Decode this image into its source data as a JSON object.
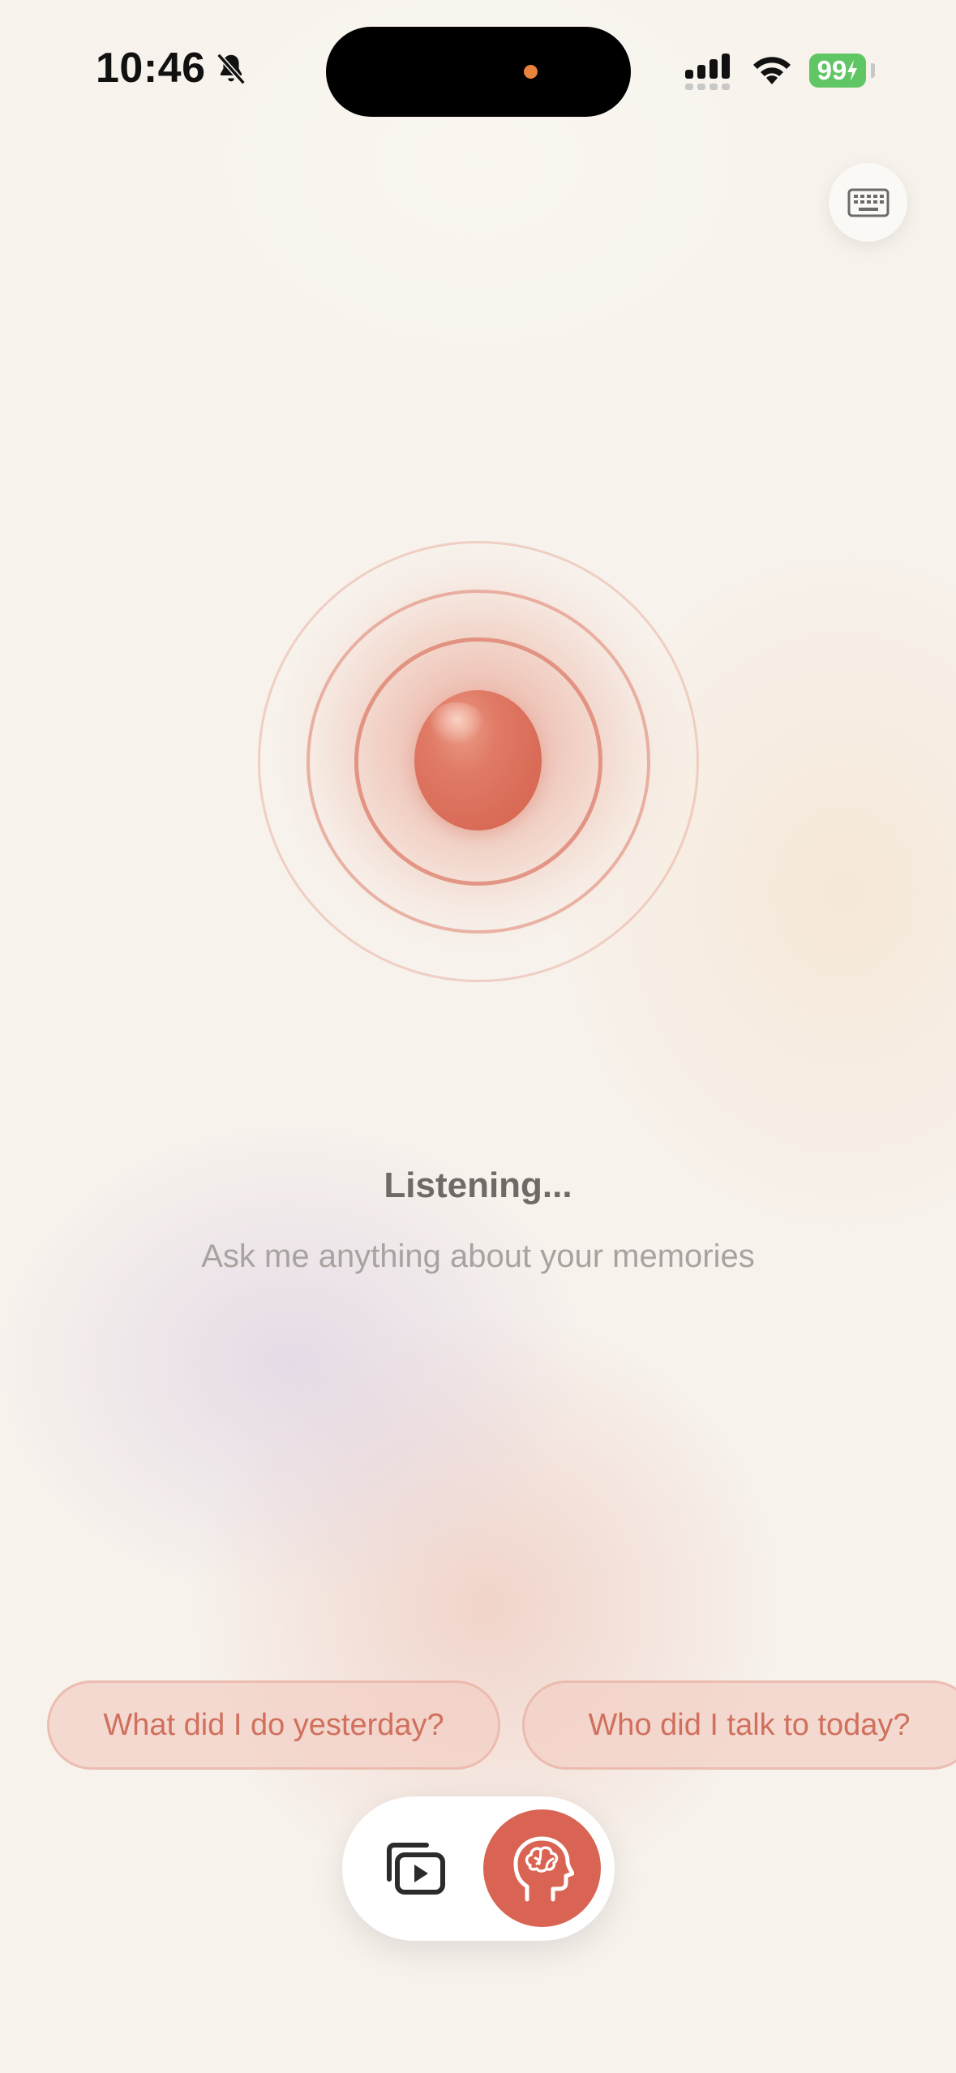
{
  "status_bar": {
    "time": "10:46",
    "battery": "99",
    "icons": [
      "bell-slash-icon",
      "cellular-signal-icon",
      "wifi-icon",
      "battery-charging-icon"
    ]
  },
  "top_controls": {
    "keyboard_icon": "keyboard-icon"
  },
  "voice": {
    "status": "Listening...",
    "prompt": "Ask me anything about your memories"
  },
  "suggestions": [
    {
      "label": "What did I do yesterday?"
    },
    {
      "label": "Who did I talk to today?"
    }
  ],
  "bottom_nav": {
    "items": [
      {
        "icon": "media-gallery-icon",
        "selected": false
      },
      {
        "icon": "brain-head-icon",
        "selected": true
      }
    ]
  },
  "colors": {
    "accent": "#d96453",
    "chip_text": "#d0705d",
    "chip_bg": "#f2cec4",
    "background": "#f7f2ec",
    "battery": "#5fc663"
  }
}
